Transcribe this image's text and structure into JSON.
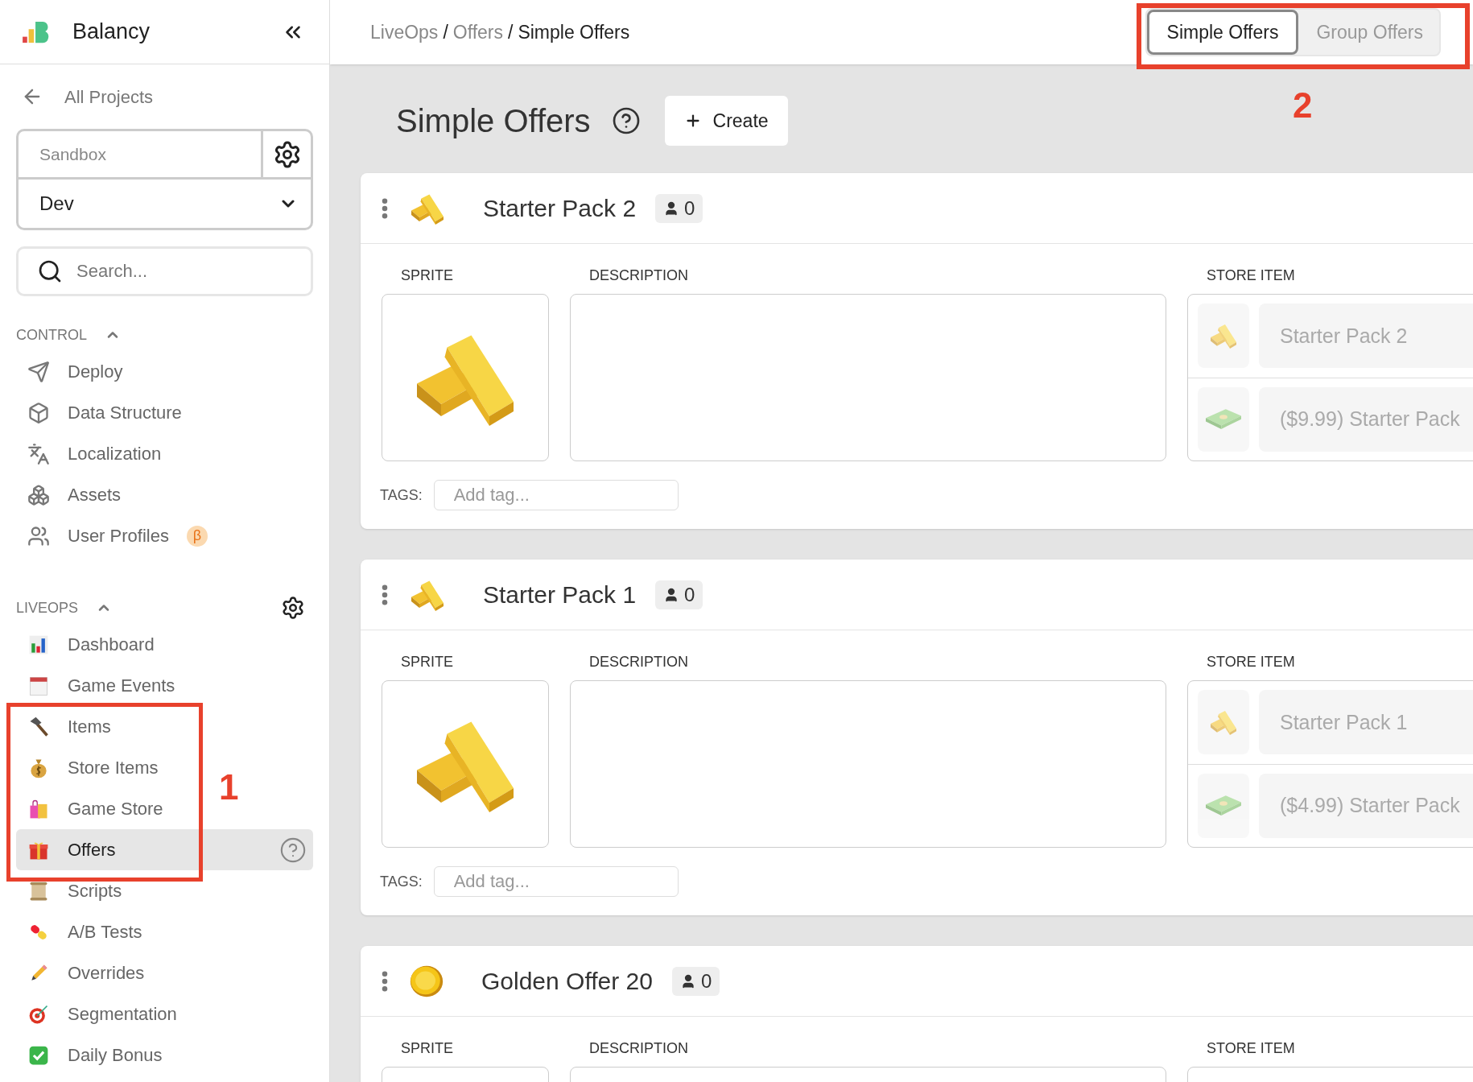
{
  "sidebar": {
    "brand": "Balancy",
    "back_link": "All Projects",
    "project": "Sandbox",
    "environment": "Dev",
    "search": {
      "placeholder": "Search..."
    },
    "sections": [
      {
        "title": "CONTROL",
        "expanded": true,
        "items": [
          {
            "label": "Deploy",
            "selected": false
          },
          {
            "label": "Data Structure",
            "selected": false
          },
          {
            "label": "Localization",
            "selected": false
          },
          {
            "label": "Assets",
            "selected": false
          },
          {
            "label": "User Profiles",
            "selected": false,
            "badge": "β"
          }
        ]
      },
      {
        "title": "LIVEOPS",
        "expanded": true,
        "items": [
          {
            "label": "Dashboard",
            "selected": false
          },
          {
            "label": "Game Events",
            "selected": false
          },
          {
            "label": "Items",
            "selected": false
          },
          {
            "label": "Store Items",
            "selected": false
          },
          {
            "label": "Game Store",
            "selected": false
          },
          {
            "label": "Offers",
            "selected": true
          },
          {
            "label": "Scripts",
            "selected": false
          },
          {
            "label": "A/B Tests",
            "selected": false
          },
          {
            "label": "Overrides",
            "selected": false
          },
          {
            "label": "Segmentation",
            "selected": false
          },
          {
            "label": "Daily Bonus",
            "selected": false
          }
        ]
      }
    ]
  },
  "breadcrumb": {
    "separator": "/",
    "items": [
      {
        "label": "LiveOps",
        "selected": false
      },
      {
        "label": "Offers",
        "selected": false
      },
      {
        "label": "Simple Offers",
        "selected": true
      }
    ]
  },
  "view_tabs": [
    {
      "label": "Simple Offers",
      "selected": true
    },
    {
      "label": "Group Offers",
      "selected": false
    }
  ],
  "page_title": "Simple Offers",
  "create_button": "Create",
  "offers": [
    {
      "name": "Starter Pack 2",
      "users": "0",
      "sprite_label": "SPRITE",
      "description_label": "DESCRIPTION",
      "store_item_label": "STORE ITEM",
      "store_items": [
        "Starter Pack 2",
        "($9.99) Starter Pack"
      ],
      "tags_label": "TAGS:",
      "tag_placeholder": "Add tag..."
    },
    {
      "name": "Starter Pack 1",
      "users": "0",
      "sprite_label": "SPRITE",
      "description_label": "DESCRIPTION",
      "store_item_label": "STORE ITEM",
      "store_items": [
        "Starter Pack 1",
        "($4.99) Starter Pack"
      ],
      "tags_label": "TAGS:",
      "tag_placeholder": "Add tag..."
    },
    {
      "name": "Golden Offer 20",
      "users": "0",
      "sprite_label": "SPRITE",
      "description_label": "DESCRIPTION",
      "store_item_label": "STORE ITEM"
    }
  ],
  "annotations": [
    {
      "label": "1"
    },
    {
      "label": "2"
    }
  ]
}
